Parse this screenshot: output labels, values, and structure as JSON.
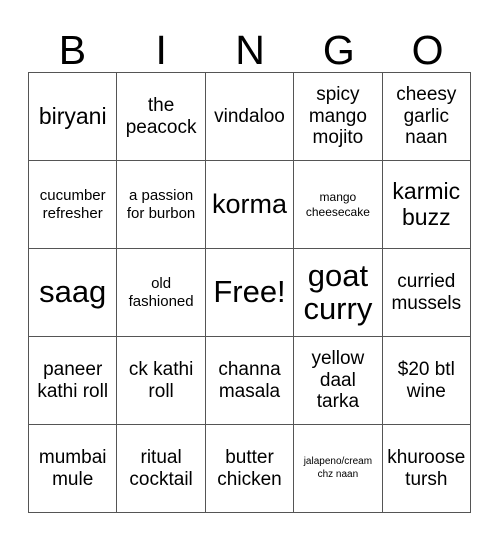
{
  "card": {
    "title": "BINGO",
    "header_letters": [
      "B",
      "I",
      "N",
      "G",
      "O"
    ],
    "rows": 5,
    "columns": 5,
    "border_color": "#555555",
    "background_color": "#ffffff",
    "text_color": "#000000",
    "free_space": {
      "label": "Free!",
      "row": 3,
      "column": 3
    },
    "cells": [
      [
        {
          "text": "biryani",
          "size": "lg"
        },
        {
          "text": "the peacock",
          "size": "md"
        },
        {
          "text": "vindaloo",
          "size": "md"
        },
        {
          "text": "spicy mango mojito",
          "size": "md"
        },
        {
          "text": "cheesy garlic naan",
          "size": "md"
        }
      ],
      [
        {
          "text": "cucumber refresher",
          "size": "sm"
        },
        {
          "text": "a passion for burbon",
          "size": "sm"
        },
        {
          "text": "korma",
          "size": "xl"
        },
        {
          "text": "mango cheesecake",
          "size": "xs"
        },
        {
          "text": "karmic buzz",
          "size": "lg"
        }
      ],
      [
        {
          "text": "saag",
          "size": "xxl"
        },
        {
          "text": "old fashioned",
          "size": "sm"
        },
        {
          "text": "Free!",
          "size": "xxl"
        },
        {
          "text": "goat curry",
          "size": "xxl"
        },
        {
          "text": "curried mussels",
          "size": "md"
        }
      ],
      [
        {
          "text": "paneer kathi roll",
          "size": "md"
        },
        {
          "text": "ck kathi roll",
          "size": "md"
        },
        {
          "text": "channa masala",
          "size": "md"
        },
        {
          "text": "yellow daal tarka",
          "size": "md"
        },
        {
          "text": "$20 btl wine",
          "size": "md"
        }
      ],
      [
        {
          "text": "mumbai mule",
          "size": "md"
        },
        {
          "text": "ritual cocktail",
          "size": "md"
        },
        {
          "text": "butter chicken",
          "size": "md"
        },
        {
          "text": "jalapeno/cream chz naan",
          "size": "xxs"
        },
        {
          "text": "khuroose tursh",
          "size": "md"
        }
      ]
    ]
  }
}
